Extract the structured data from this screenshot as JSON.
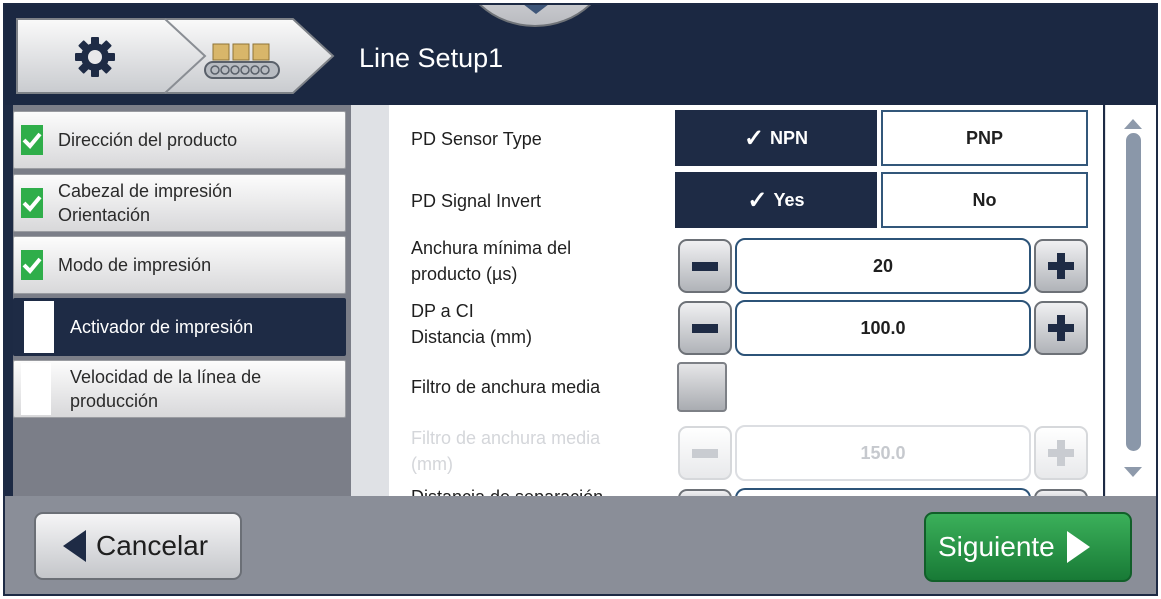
{
  "header": {
    "title": "Line Setup1",
    "home_icon": "gear-icon",
    "step_icon": "conveyor-icon",
    "pull_tab_icon": "chevron-down-icon"
  },
  "nav": {
    "items": [
      {
        "label_line1": "Dirección del producto",
        "label_line2": "",
        "status": "complete"
      },
      {
        "label_line1": "Cabezal de impresión",
        "label_line2": "Orientación",
        "status": "complete"
      },
      {
        "label_line1": "Modo de impresión",
        "label_line2": "",
        "status": "complete"
      },
      {
        "label_line1": "Activador de impresión",
        "label_line2": "",
        "status": "active"
      },
      {
        "label_line1": "Velocidad de la línea de",
        "label_line2": "producción",
        "status": "pending"
      }
    ]
  },
  "settings": {
    "sensor_type": {
      "label": "PD Sensor Type",
      "options": [
        "NPN",
        "PNP"
      ],
      "selected": "NPN",
      "check": "✓"
    },
    "signal_invert": {
      "label": "PD Signal Invert",
      "options": [
        "Yes",
        "No"
      ],
      "selected": "Yes",
      "check": "✓"
    },
    "min_width": {
      "label_line1": "Anchura mínima del",
      "label_line2": "producto (µs)",
      "value": "20"
    },
    "pd_distance": {
      "label_line1": "DP a CI",
      "label_line2": "Distancia  (mm)",
      "value": "100.0"
    },
    "avg_width_filter": {
      "label": "Filtro de anchura media",
      "checked": false
    },
    "avg_width_filter_mm": {
      "label_line1": "Filtro de anchura media",
      "label_line2": "(mm)",
      "value": "150.0",
      "enabled": false
    },
    "next_row": {
      "label_partial": "Distancia de separación"
    }
  },
  "footer": {
    "cancel_label": "Cancelar",
    "next_label": "Siguiente"
  },
  "colors": {
    "navy": "#1e2b45",
    "green": "#2fae4a",
    "next_button": "#1f8a3f"
  }
}
